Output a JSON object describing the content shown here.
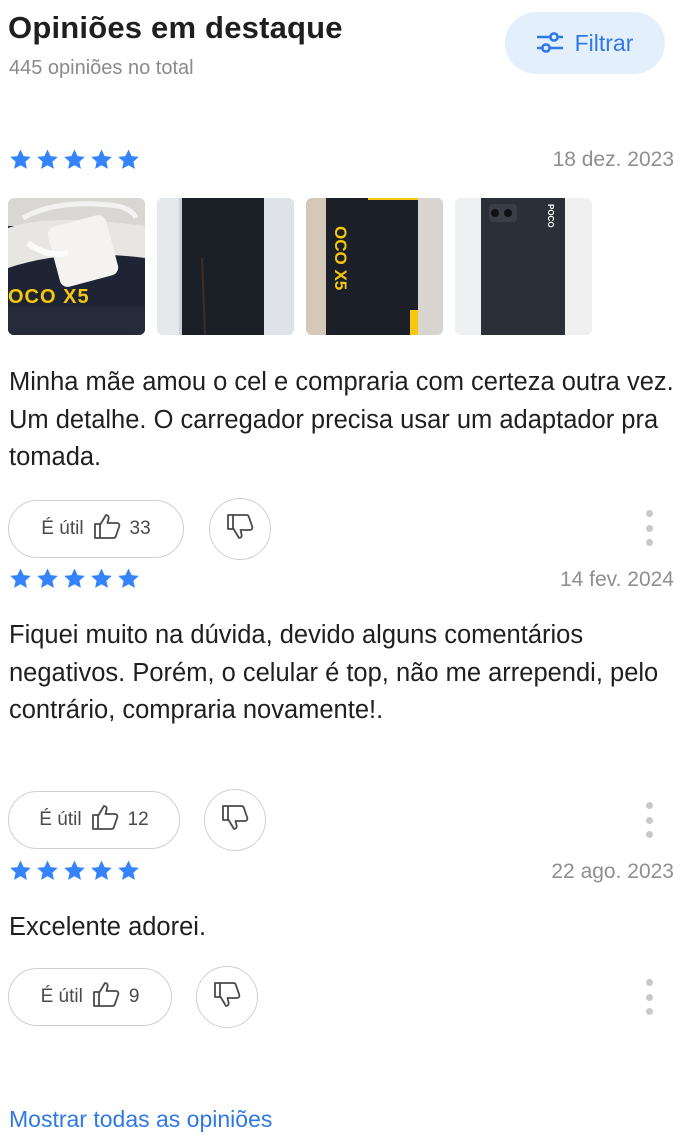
{
  "header": {
    "title": "Opiniões em destaque",
    "total": "445 opiniões no total",
    "filter_label": "Filtrar",
    "filter_icon": "sliders-icon"
  },
  "colors": {
    "accent": "#2f78e6",
    "star": "#3483fa",
    "filter_bg": "#e4effc",
    "muted": "#8f8f8f"
  },
  "reviews": [
    {
      "rating": 5,
      "date": "18 dez. 2023",
      "photos": [
        {
          "label": "OCO X5"
        },
        {
          "label": ""
        },
        {
          "label": "OCO X5"
        },
        {
          "label": "POCO"
        }
      ],
      "text": "Minha mãe amou o cel e compraria com certeza outra vez. Um detalhe. O carregador precisa usar um adaptador pra tomada.",
      "useful_label": "É útil",
      "useful_count": "33"
    },
    {
      "rating": 5,
      "date": "14 fev. 2024",
      "text": "Fiquei muito na dúvida, devido alguns comentários negativos. Porém, o celular é top, não me arrependi, pelo contrário, compraria novamente!.",
      "useful_label": "É útil",
      "useful_count": "12"
    },
    {
      "rating": 5,
      "date": "22 ago. 2023",
      "text": "Excelente adorei.",
      "useful_label": "É útil",
      "useful_count": "9"
    }
  ],
  "footer": {
    "show_all": "Mostrar todas as opiniões"
  }
}
